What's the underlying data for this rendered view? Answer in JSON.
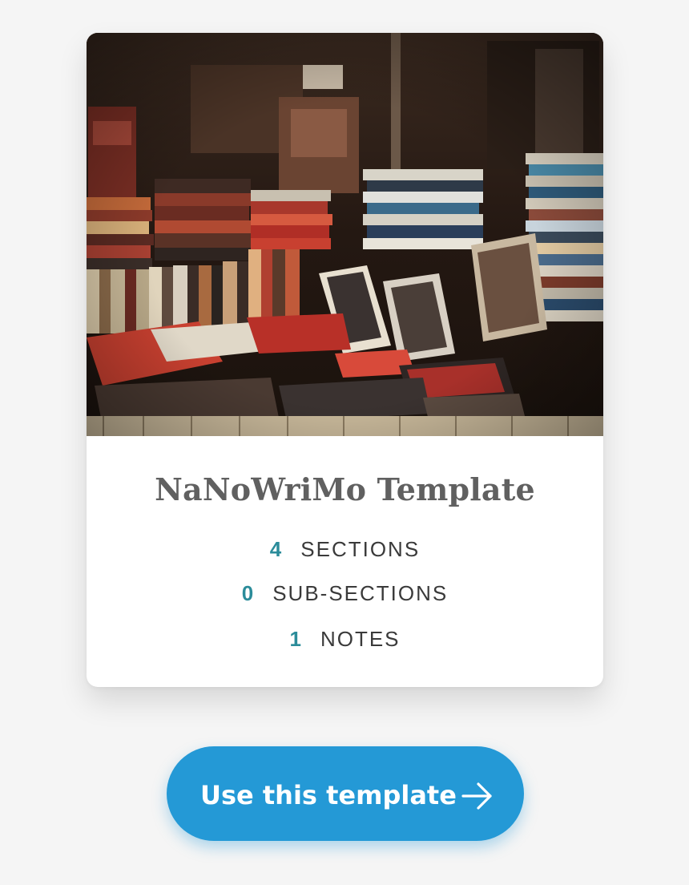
{
  "card": {
    "image_label": "books-photo",
    "title": "NaNoWriMo Template",
    "stats": [
      {
        "value": "4",
        "label": "SECTIONS"
      },
      {
        "value": "0",
        "label": "SUB-SECTIONS"
      },
      {
        "value": "1",
        "label": "NOTES"
      }
    ]
  },
  "button": {
    "label": "Use this template",
    "icon": "arrow-right-icon",
    "color": "#2499d6"
  },
  "colors": {
    "accent_number": "#2b8c9a",
    "title": "#606060",
    "background": "#f5f5f5"
  }
}
